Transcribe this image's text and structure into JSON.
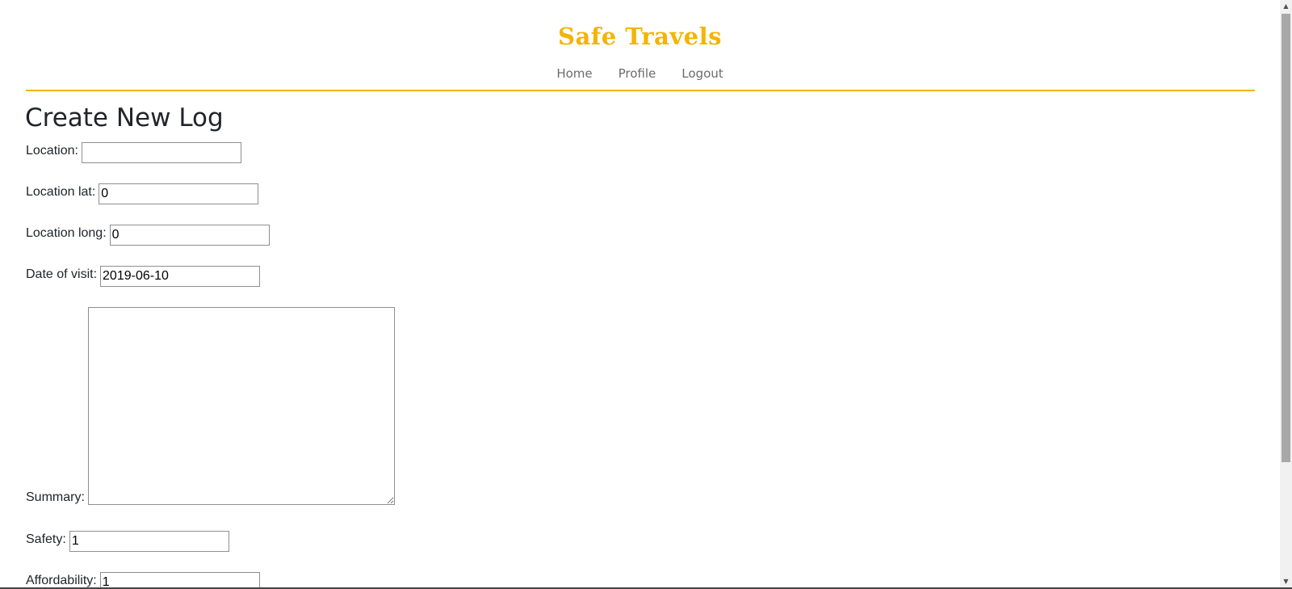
{
  "brand": {
    "title": "Safe Travels",
    "color": "#f4b400"
  },
  "nav": {
    "items": [
      {
        "label": "Home"
      },
      {
        "label": "Profile"
      },
      {
        "label": "Logout"
      }
    ]
  },
  "form": {
    "title": "Create New Log",
    "fields": {
      "location": {
        "label": "Location:",
        "value": ""
      },
      "location_lat": {
        "label": "Location lat:",
        "value": "0"
      },
      "location_long": {
        "label": "Location long:",
        "value": "0"
      },
      "date_of_visit": {
        "label": "Date of visit:",
        "value": "2019-06-10"
      },
      "summary": {
        "label": "Summary:",
        "value": ""
      },
      "safety": {
        "label": "Safety:",
        "value": "1"
      },
      "affordability": {
        "label": "Affordability:",
        "value": "1"
      }
    }
  },
  "icons": {
    "scroll_up": "triangle-up-icon",
    "scroll_down": "triangle-down-icon"
  }
}
